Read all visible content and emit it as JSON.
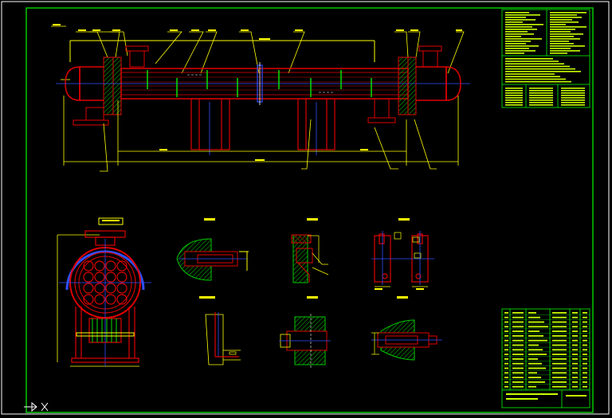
{
  "colors": {
    "background": "#000000",
    "frame": "#ffffff",
    "border": "#00c800",
    "shell": "#e00000",
    "dimension": "#ffff00",
    "centerline": "#3050ff",
    "baffle": "#00e000",
    "hatch": "#00b000",
    "table_text": "#c8ff00"
  },
  "drawing": {
    "elevation_view": "shell-and-tube-elevation",
    "section_view": "tube-bundle-cross-section",
    "detail_views": [
      "detail-1",
      "detail-2",
      "detail-3",
      "detail-4",
      "detail-5",
      "detail-6"
    ]
  },
  "ucs_icon": "ucs-axis-icon"
}
